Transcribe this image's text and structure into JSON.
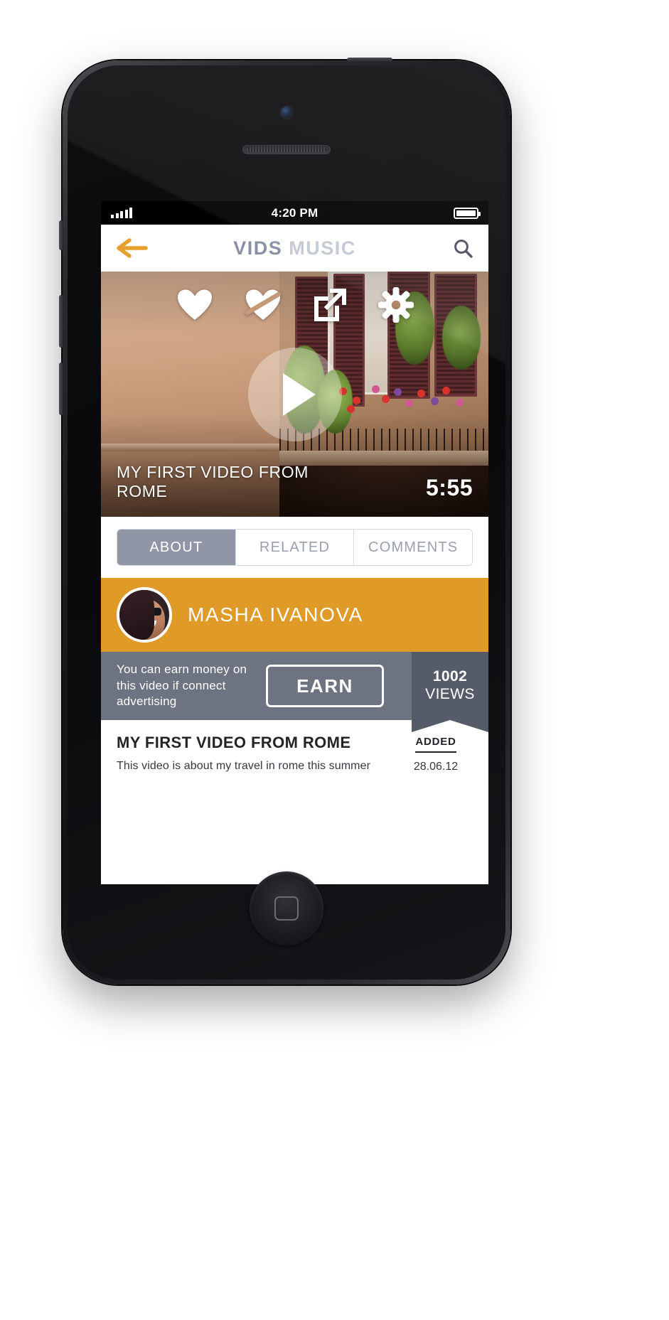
{
  "status_bar": {
    "signal_icon": "signal-bars-icon",
    "time": "4:20 PM",
    "battery_icon": "battery-full-icon"
  },
  "nav_bar": {
    "back_icon": "back-arrow-icon",
    "brand_primary": "VIDS",
    "brand_secondary": "MUSIC",
    "search_icon": "search-icon"
  },
  "video": {
    "actions": [
      {
        "name": "favorite-icon",
        "label": "Favorite"
      },
      {
        "name": "unfavorite-icon",
        "label": "Unfavorite"
      },
      {
        "name": "share-icon",
        "label": "Share"
      },
      {
        "name": "settings-gear-icon",
        "label": "Settings"
      }
    ],
    "play_icon": "play-icon",
    "title": "MY FIRST VIDEO FROM ROME",
    "duration": "5:55"
  },
  "tabs": [
    {
      "label": "ABOUT",
      "active": true
    },
    {
      "label": "RELATED",
      "active": false
    },
    {
      "label": "COMMENTS",
      "active": false
    }
  ],
  "author": {
    "avatar_icon": "avatar",
    "name": "MASHA IVANOVA"
  },
  "earn": {
    "message": "You can earn money on this video if connect advertising",
    "button_label": "EARN",
    "views_count": "1002",
    "views_label": "VIEWS"
  },
  "description": {
    "title": "MY FIRST VIDEO FROM ROME",
    "body": "This video is about my travel in rome this summer",
    "added_label": "ADDED",
    "added_date": "28.06.12"
  },
  "colors": {
    "accent_orange": "#e09a28",
    "slate": "#6d7381",
    "slate_dark": "#555b68",
    "tab_active": "#9096a6",
    "brand_primary": "#8990a3",
    "brand_secondary": "#c3c7d2"
  }
}
